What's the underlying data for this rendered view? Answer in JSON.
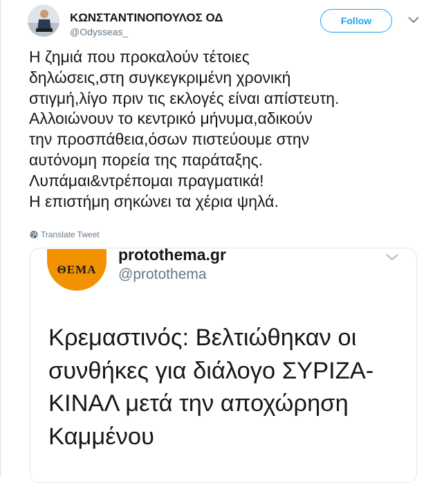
{
  "tweet": {
    "author_name": "ΚΩΝΣΤΑΝΤΙΝΟΠΟΥΛΟΣ ΟΔ",
    "author_handle": "@Odysseas_",
    "follow_label": "Follow",
    "text_lines": [
      "Η ζημιά που προκαλούν τέτοιες",
      "δηλώσεις,στη συγκεγκριμένη χρονική",
      "στιγμή,λίγο πριν τις εκλογές είναι απίστευτη.",
      "Αλλοιώνουν το κεντρικό μήνυμα,αδικούν",
      "την προσπάθεια,όσων πιστεύουμε στην",
      "αυτόνομη πορεία της παράταξης.",
      "Λυπάμαι&ντρέπομαι πραγματικά!",
      "Η επιστήμη σηκώνει τα χέρια ψηλά."
    ],
    "translate_label": "Translate Tweet"
  },
  "quoted": {
    "avatar_text": "ΘΕΜΑ",
    "name": "protothema.gr",
    "handle": "@protothema",
    "text_lines": [
      "Κρεμαστινός: Βελτιώθηκαν οι",
      "συνθήκες για διάλογο ΣΥΡΙΖΑ-",
      "ΚΙΝΑΛ μετά την αποχώρηση",
      "Καμμένου"
    ]
  },
  "colors": {
    "accent": "#1da1f2",
    "muted": "#657786",
    "text": "#14171a",
    "brand_orange": "#f39200"
  },
  "icons": {
    "tweet_menu": "chevron-down-icon",
    "translate": "globe-icon",
    "quote_menu": "chevron-down-icon"
  }
}
